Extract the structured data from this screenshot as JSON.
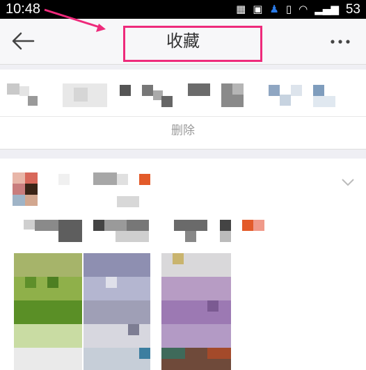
{
  "status_bar": {
    "time": "10:48",
    "battery": "53"
  },
  "header": {
    "title": "收藏",
    "back_icon": "back-arrow-icon",
    "more_icon": "more-dots-icon"
  },
  "actions": {
    "delete_label": "删除"
  },
  "colors": {
    "annotation": "#ee2a7b",
    "accent_orange": "#e35b2a"
  }
}
